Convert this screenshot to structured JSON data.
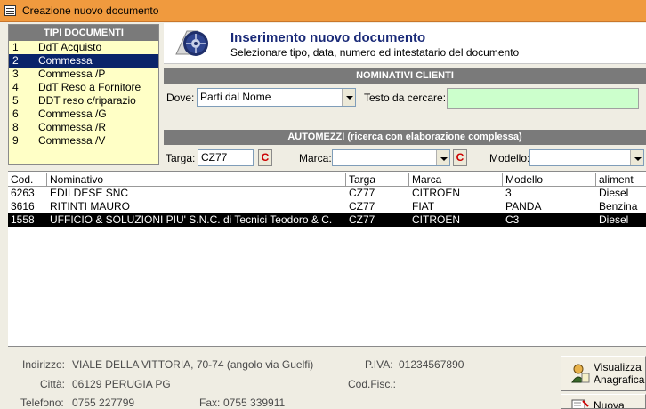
{
  "window": {
    "title": "Creazione nuovo documento"
  },
  "tipi": {
    "header": "TIPI DOCUMENTI",
    "items": [
      {
        "num": "1",
        "label": "DdT Acquisto"
      },
      {
        "num": "2",
        "label": "Commessa"
      },
      {
        "num": "3",
        "label": "Commessa /P"
      },
      {
        "num": "4",
        "label": "DdT Reso a Fornitore"
      },
      {
        "num": "5",
        "label": "DDT reso c/riparazio"
      },
      {
        "num": "6",
        "label": "Commessa /G"
      },
      {
        "num": "8",
        "label": "Commessa /R"
      },
      {
        "num": "9",
        "label": "Commessa /V"
      }
    ],
    "selected_index": 1
  },
  "header": {
    "title": "Inserimento nuovo documento",
    "subtitle": "Selezionare tipo, data, numero ed intestatario del documento"
  },
  "clienti": {
    "band": "NOMINATIVI CLIENTI",
    "dove_label": "Dove:",
    "dove_value": "Parti dal Nome",
    "testo_label": "Testo da cercare:",
    "testo_value": ""
  },
  "automezzi": {
    "band": "AUTOMEZZI (ricerca con elaborazione complessa)",
    "targa_label": "Targa:",
    "targa_value": "CZ77",
    "marca_label": "Marca:",
    "marca_value": "",
    "modello_label": "Modello:",
    "modello_value": "",
    "clear_label": "C"
  },
  "grid": {
    "columns": [
      "Cod.",
      "Nominativo",
      "Targa",
      "Marca",
      "Modello",
      "aliment"
    ],
    "rows": [
      [
        "6263",
        "EDILDESE SNC",
        "CZ77",
        "CITROEN",
        "3",
        "Diesel"
      ],
      [
        "3616",
        "RITINTI MAURO",
        "CZ77",
        "FIAT",
        "PANDA",
        "Benzina"
      ],
      [
        "1558",
        "UFFICIO & SOLUZIONI PIU' S.N.C. di Tecnici Teodoro & C.",
        "CZ77",
        "CITROEN",
        "C3",
        "Diesel"
      ]
    ],
    "selected_index": 2
  },
  "footer": {
    "indirizzo_label": "Indirizzo:",
    "indirizzo_value": "VIALE DELLA VITTORIA, 70-74 (angolo via Guelfi)",
    "citta_label": "Città:",
    "citta_value": "06129 PERUGIA PG",
    "telefono_label": "Telefono:",
    "telefono_value": "0755 227799",
    "fax_label": "Fax:",
    "fax_value": "0755 339911",
    "piva_label": "P.IVA:",
    "piva_value": "01234567890",
    "codfisc_label": "Cod.Fisc.:",
    "codfisc_value": ""
  },
  "buttons": {
    "visualizza_line1": "Visualizza",
    "visualizza_line2": "Anagrafica",
    "nuova": "Nuova"
  }
}
